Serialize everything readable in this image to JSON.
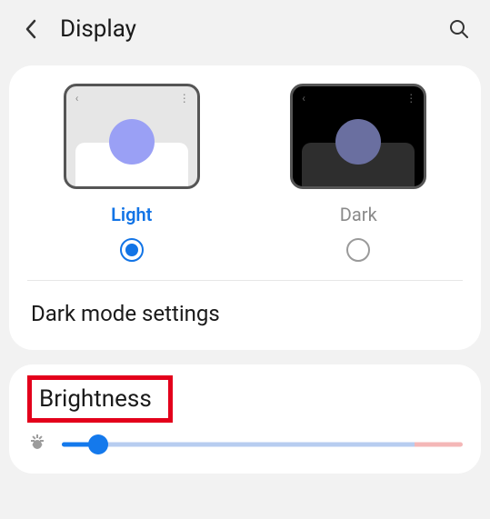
{
  "header": {
    "title": "Display"
  },
  "themes": {
    "light_label": "Light",
    "dark_label": "Dark",
    "selected": "light"
  },
  "dark_mode_settings_label": "Dark mode settings",
  "brightness": {
    "label": "Brightness",
    "value_percent": 9,
    "warn_threshold_percent": 88
  },
  "icons": {
    "back": "back-arrow-icon",
    "search": "search-icon",
    "sun": "brightness-sun-icon"
  },
  "colors": {
    "accent": "#1479ec",
    "highlight_border": "#e3001b"
  }
}
